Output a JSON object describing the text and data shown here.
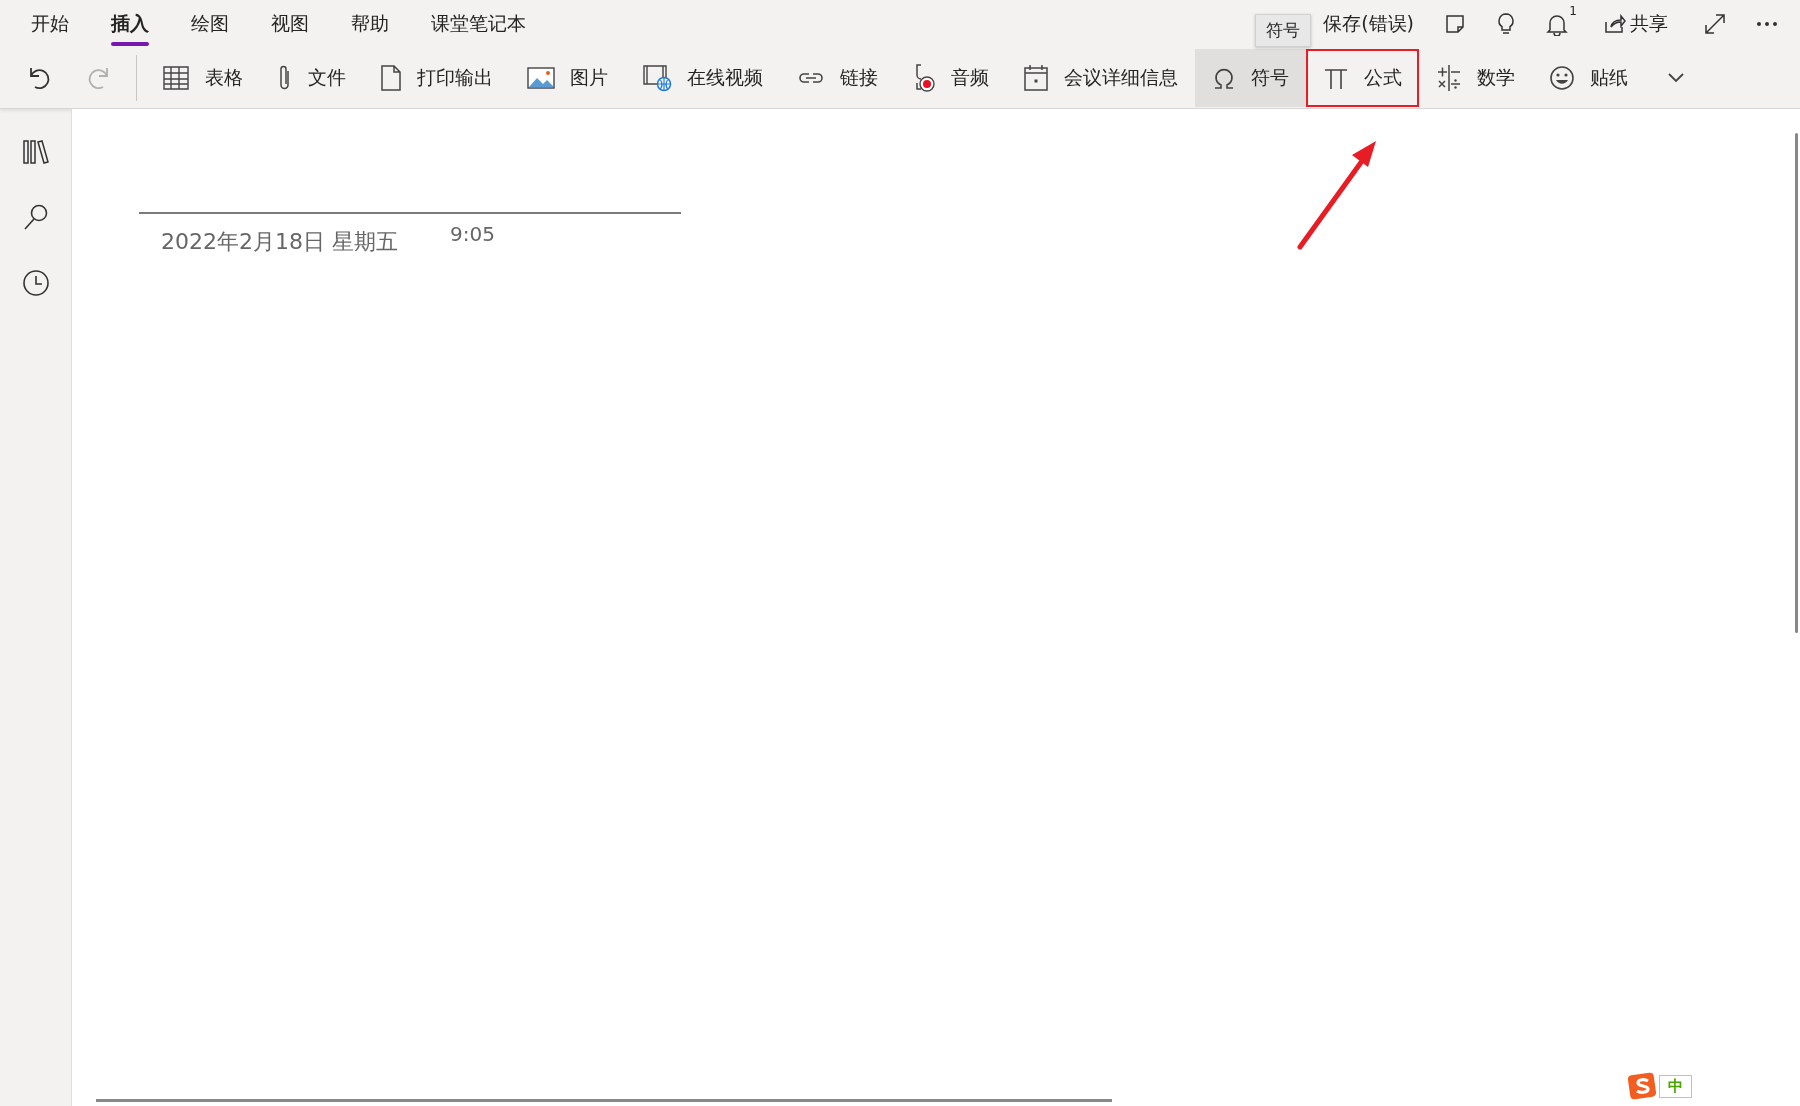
{
  "menu_tabs": [
    {
      "label": "开始",
      "selected": false
    },
    {
      "label": "插入",
      "selected": true
    },
    {
      "label": "绘图",
      "selected": false
    },
    {
      "label": "视图",
      "selected": false
    },
    {
      "label": "帮助",
      "selected": false
    },
    {
      "label": "课堂笔记本",
      "selected": false
    }
  ],
  "save_status": "保存(错误)",
  "tooltip": "符号",
  "notification_count": "1",
  "share_label": "共享",
  "history": [
    {
      "kind": "undo",
      "disabled": false
    },
    {
      "kind": "redo",
      "disabled": true
    }
  ],
  "toolbar": [
    {
      "label": "表格",
      "hovered": false,
      "callout": false
    },
    {
      "label": "文件",
      "hovered": false,
      "callout": false
    },
    {
      "label": "打印输出",
      "hovered": false,
      "callout": false
    },
    {
      "label": "图片",
      "hovered": false,
      "callout": false
    },
    {
      "label": "在线视频",
      "hovered": false,
      "callout": false
    },
    {
      "label": "链接",
      "hovered": false,
      "callout": false
    },
    {
      "label": "音频",
      "hovered": false,
      "callout": false
    },
    {
      "label": "会议详细信息",
      "hovered": false,
      "callout": false
    },
    {
      "label": "符号",
      "hovered": true,
      "callout": false
    },
    {
      "label": "公式",
      "hovered": false,
      "callout": true
    },
    {
      "label": "数学",
      "hovered": false,
      "callout": false
    },
    {
      "label": "贴纸",
      "hovered": false,
      "callout": false
    }
  ],
  "page": {
    "date": "2022年2月18日 星期五",
    "time": "9:05"
  },
  "ime_mode": "中"
}
